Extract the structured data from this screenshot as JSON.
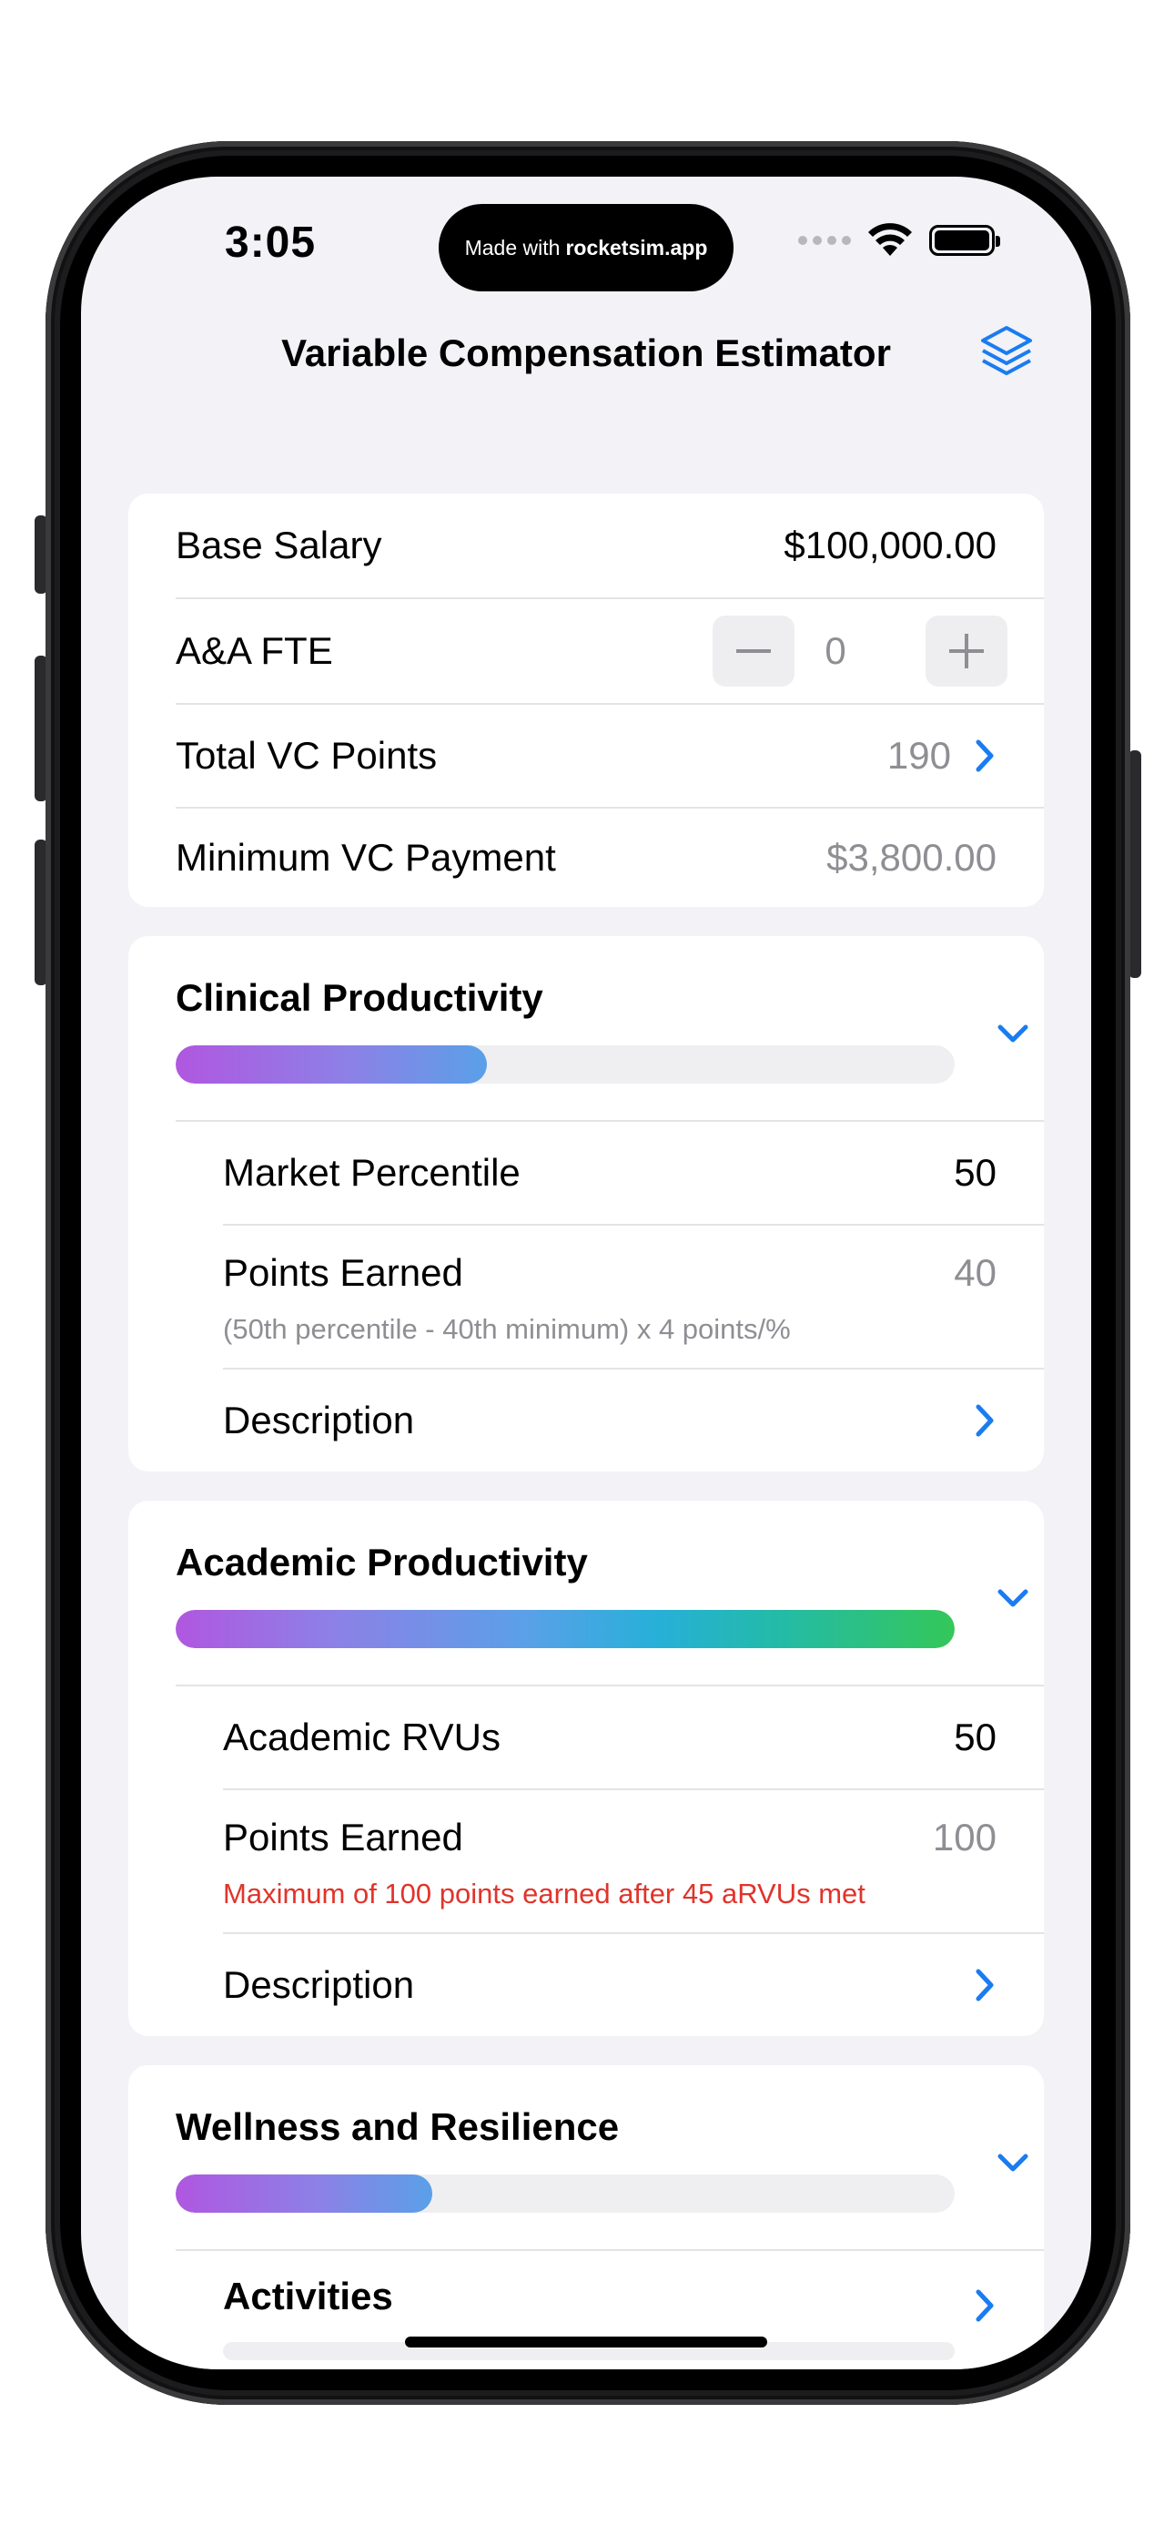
{
  "status_bar": {
    "time": "3:05",
    "island_prefix": "Made with",
    "island_brand": "rocketsim.app"
  },
  "nav": {
    "title": "Variable Compensation Estimator",
    "icon": "layers-icon"
  },
  "summary": {
    "base_salary_label": "Base Salary",
    "base_salary_value": "$100,000.00",
    "fte_label": "A&A FTE",
    "fte_value": "0",
    "total_points_label": "Total VC Points",
    "total_points_value": "190",
    "min_payment_label": "Minimum VC Payment",
    "min_payment_value": "$3,800.00"
  },
  "clinical": {
    "title": "Clinical Productivity",
    "progress": 0.4,
    "market_label": "Market Percentile",
    "market_value": "50",
    "points_label": "Points Earned",
    "points_value": "40",
    "points_note": "(50th percentile - 40th minimum) x 4 points/%",
    "description_label": "Description"
  },
  "academic": {
    "title": "Academic Productivity",
    "progress": 1.0,
    "rvus_label": "Academic RVUs",
    "rvus_value": "50",
    "points_label": "Points Earned",
    "points_value": "100",
    "points_note": "Maximum of 100 points earned after 45 aRVUs met",
    "description_label": "Description"
  },
  "wellness": {
    "title": "Wellness and Resilience",
    "progress": 0.33,
    "activities_label": "Activities"
  },
  "colors": {
    "accent": "#1a7cf0",
    "warning": "#e0342b",
    "background": "#f2f2f7"
  }
}
